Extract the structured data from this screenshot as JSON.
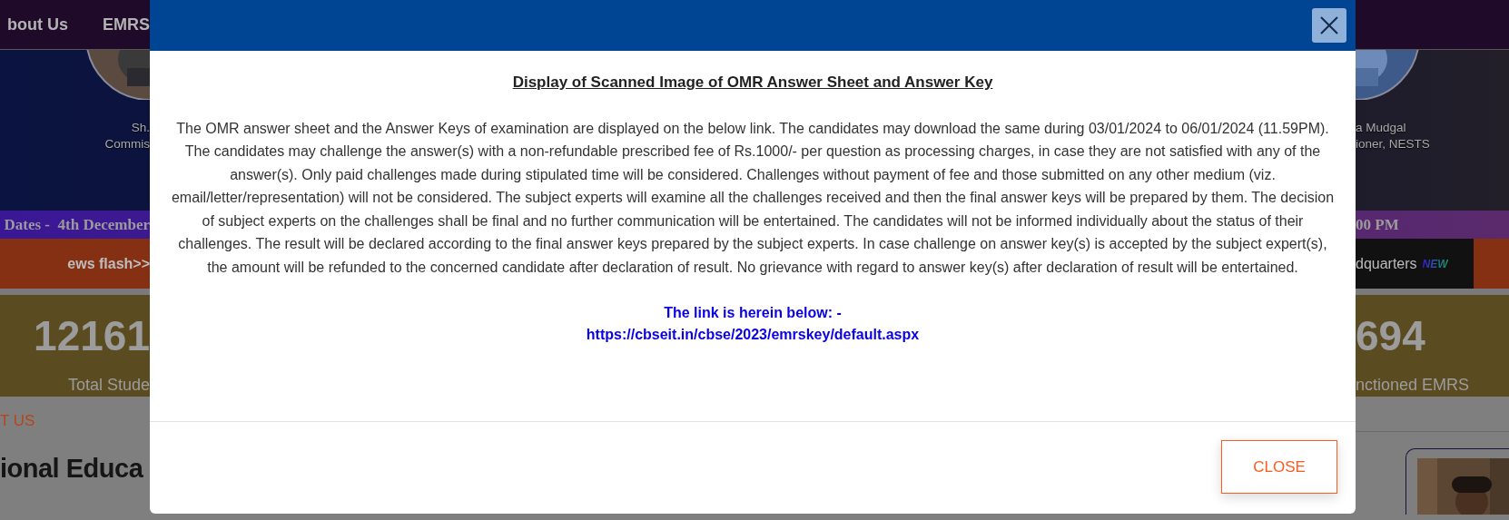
{
  "background_page": {
    "nav_items": [
      "bout Us",
      "EMRS"
    ],
    "officials": [
      {
        "name": "Sh.",
        "title": "Commis"
      },
      {
        "name": "a Mudgal",
        "title": "ioner, NESTS"
      }
    ],
    "ticker": {
      "left": "Dates -  4th December",
      "right": "00 PM"
    },
    "news_flash": {
      "label": "ews flash>>",
      "item": "dquarters",
      "badge": "NEW"
    },
    "stats": [
      {
        "value": "12161",
        "label": "Total Stude"
      },
      {
        "value": "694",
        "label": "nctioned EMRS"
      }
    ],
    "about": {
      "eyebrow": "T US",
      "heading": "ional Educa"
    }
  },
  "modal": {
    "title": "Display of Scanned Image of OMR Answer Sheet and Answer Key",
    "paragraph": "The OMR answer sheet and the Answer Keys of examination are displayed on the below link. The candidates may download the same during 03/01/2024 to 06/01/2024 (11.59PM). The candidates may challenge the answer(s) with a non-refundable prescribed fee of Rs.1000/- per question as processing charges, in case they are not satisfied with any of the answer(s). Only paid challenges made during stipulated time will be considered. Challenges without payment of fee and those submitted on any other medium (viz. email/letter/representation) will not be considered. The subject experts will examine all the challenges received and then the final answer keys will be prepared by them. The decision of subject experts on the challenges shall be final and no further communication will be entertained. The candidates will not be informed individually about the status of their challenges. The result will be declared according to the final answer keys prepared by the subject experts. In case challenge on answer key(s) is accepted by the subject expert(s), the amount will be refunded to the concerned candidate after declaration of result. No grievance with regard to answer key(s) after declaration of result will be entertained.",
    "link_intro": "The link is herein below: -",
    "link_url": "https://cbseit.in/cbse/2023/emrskey/default.aspx",
    "close_button": "CLOSE"
  }
}
